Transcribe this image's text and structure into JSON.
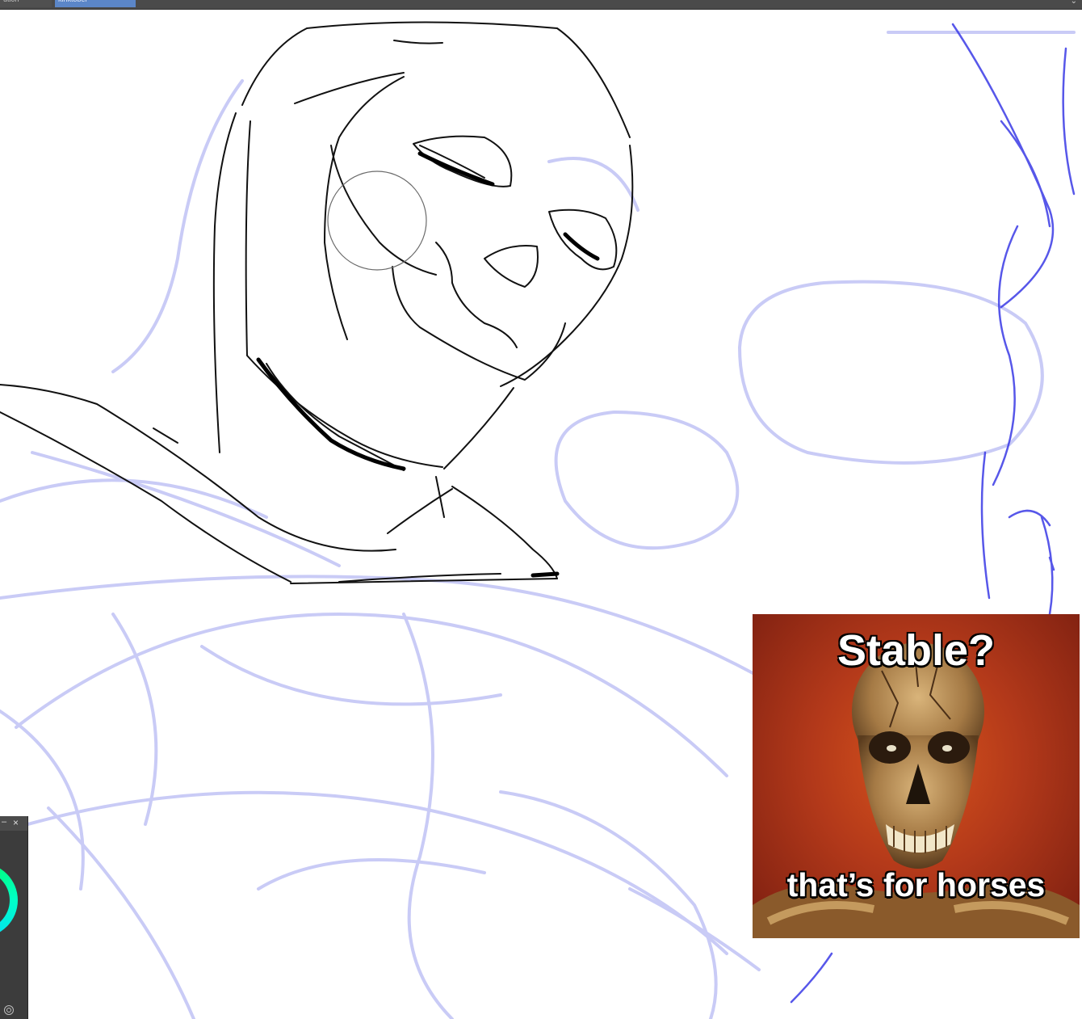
{
  "tabs": [
    {
      "label": "ution",
      "active": false,
      "close_icon": "close-icon"
    },
    {
      "label": "kinktober",
      "active": true,
      "close_icon": "close-icon"
    }
  ],
  "tab_menu_icon": "chevron-down-icon",
  "canvas": {
    "content": "character sketch with rough blue construction lines",
    "line_colors": {
      "ink": "#111111",
      "rough": "#c9cbf6",
      "blue": "#3a3ae6"
    }
  },
  "palette": {
    "minimize_glyph": "–",
    "close_glyph": "×",
    "wheel_colors": [
      "#00ff66",
      "#00e8ff"
    ]
  },
  "meme": {
    "top_text": "Stable?",
    "bottom_text": "that’s for horses"
  }
}
